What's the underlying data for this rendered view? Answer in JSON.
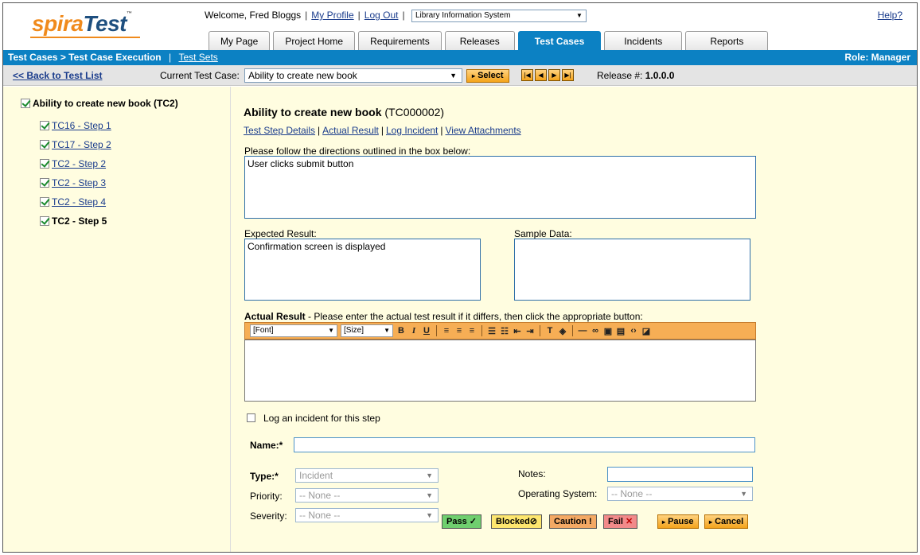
{
  "header": {
    "logo_part1": "spira",
    "logo_part2": "Test",
    "logo_tm": "™",
    "welcome": "Welcome, Fred Bloggs",
    "my_profile": "My Profile",
    "log_out": "Log Out",
    "project": "Library Information System",
    "help": "Help?"
  },
  "tabs": [
    "My Page",
    "Project Home",
    "Requirements",
    "Releases",
    "Test Cases",
    "Incidents",
    "Reports"
  ],
  "active_tab": "Test Cases",
  "bluebar": {
    "breadcrumb": "Test Cases > Test Case Execution",
    "test_sets": "Test Sets",
    "role": "Role: Manager"
  },
  "toolbar": {
    "back": "<< Back to Test List",
    "current_label": "Current Test Case:",
    "current_value": "Ability to create new book",
    "select_label": "Select",
    "release_label": "Release #:",
    "release_value": "1.0.0.0"
  },
  "tree": {
    "root": "Ability to create new book (TC2)",
    "steps": [
      "TC16 - Step 1",
      "TC17 - Step 2",
      "TC2 - Step 2",
      "TC2 - Step 3",
      "TC2 - Step 4",
      "TC2 - Step 5"
    ]
  },
  "main": {
    "title": "Ability to create new book",
    "code": "(TC000002)",
    "links": [
      "Test Step Details",
      "Actual Result",
      "Log Incident",
      "View Attachments"
    ],
    "directions_label": "Please follow the directions outlined in the box below:",
    "directions": "User clicks submit button",
    "expected_label": "Expected Result:",
    "expected": "Confirmation screen is displayed",
    "sample_label": "Sample Data:",
    "sample": "",
    "actual_label_bold": "Actual Result",
    "actual_label_rest": " - Please enter the actual test result if it differs, then click the appropriate button:",
    "font_select": "[Font]",
    "size_select": "[Size]"
  },
  "incident": {
    "checkbox_label": "Log an incident for this step",
    "name_label": "Name:*",
    "type_label": "Type:*",
    "type_value": "Incident",
    "priority_label": "Priority:",
    "priority_value": "-- None --",
    "severity_label": "Severity:",
    "severity_value": "-- None --",
    "notes_label": "Notes:",
    "os_label": "Operating System:",
    "os_value": "-- None --"
  },
  "actions": {
    "pass": "Pass",
    "blocked": "Blocked",
    "caution": "Caution",
    "fail": "Fail",
    "pause": "Pause",
    "cancel": "Cancel"
  },
  "colors": {
    "accent_blue": "#0c81c3",
    "panel_bg": "#fffde0",
    "toolbar_orange": "#f6ae55"
  }
}
